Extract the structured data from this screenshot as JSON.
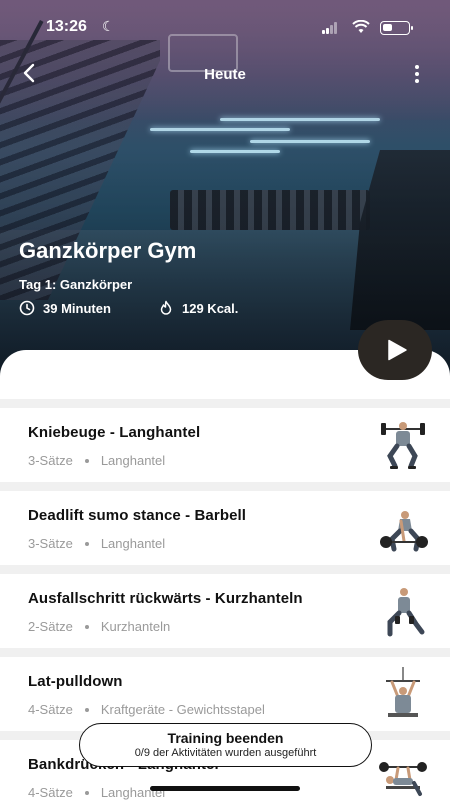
{
  "status_bar": {
    "time": "13:26"
  },
  "header": {
    "title": "Heute"
  },
  "workout": {
    "title": "Ganzkörper Gym",
    "day": "Tag 1: Ganzkörper",
    "duration": "39 Minuten",
    "calories": "129 Kcal."
  },
  "exercises": [
    {
      "name": "Kniebeuge - Langhantel",
      "sets": "3-Sätze",
      "equipment": "Langhantel",
      "icon": "squat-figure-icon"
    },
    {
      "name": "Deadlift sumo stance - Barbell",
      "sets": "3-Sätze",
      "equipment": "Langhantel",
      "icon": "deadlift-figure-icon"
    },
    {
      "name": "Ausfallschritt rückwärts - Kurzhanteln",
      "sets": "2-Sätze",
      "equipment": "Kurzhanteln",
      "icon": "lunge-figure-icon"
    },
    {
      "name": "Lat-pulldown",
      "sets": "4-Sätze",
      "equipment": "Kraftgeräte - Gewichtsstapel",
      "icon": "pulldown-figure-icon"
    },
    {
      "name": "Bankdrücken - Langhantel",
      "sets": "4-Sätze",
      "equipment": "Langhantel",
      "icon": "bench-press-figure-icon"
    }
  ],
  "finish": {
    "label": "Training beenden",
    "progress_text": "0/9 der Aktivitäten wurden ausgeführt"
  },
  "colors": {
    "accent_dark": "#2b2723",
    "muted_text": "#9a9a9a",
    "divider": "#f0f0f0"
  }
}
